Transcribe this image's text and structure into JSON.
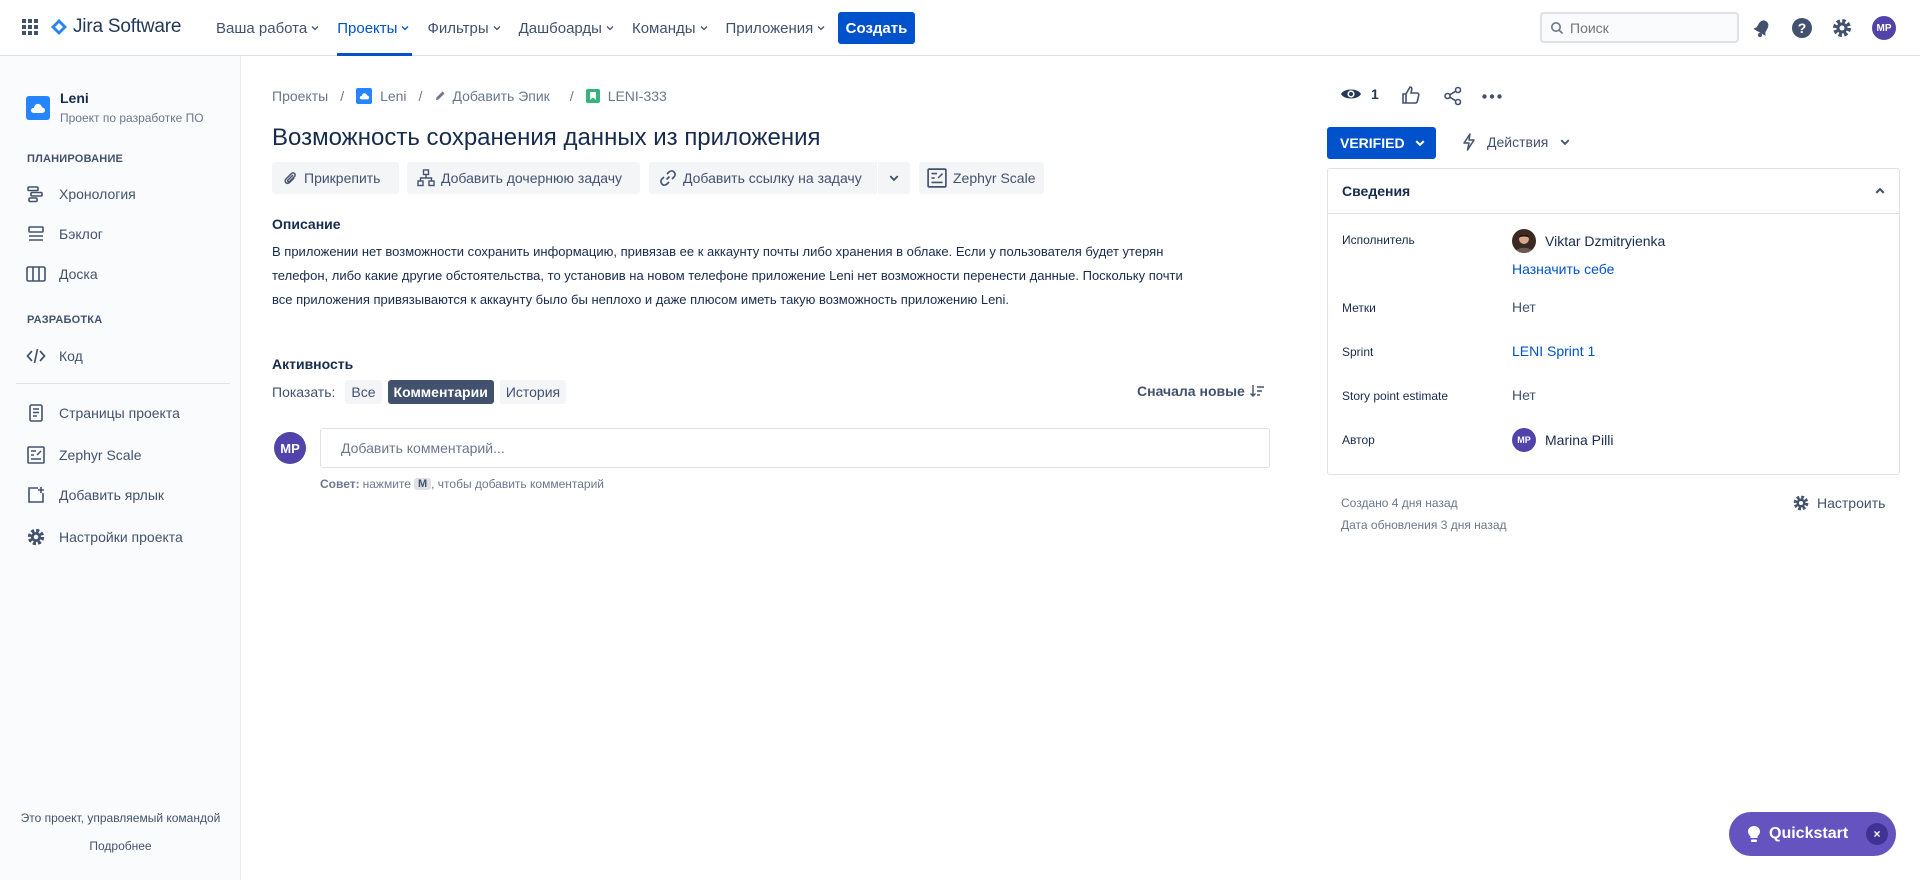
{
  "app": {
    "logo_text": "Jira Software",
    "brand_color": "#0052cc"
  },
  "nav": {
    "items": [
      {
        "label": "Ваша работа"
      },
      {
        "label": "Проекты"
      },
      {
        "label": "Фильтры"
      },
      {
        "label": "Дашбоарды"
      },
      {
        "label": "Команды"
      },
      {
        "label": "Приложения"
      }
    ],
    "active": "Проекты",
    "create_label": "Создать",
    "search_placeholder": "Поиск",
    "user_initials": "MP"
  },
  "sidebar": {
    "project_name": "Leni",
    "project_desc": "Проект по разработке ПО",
    "section_planning": "ПЛАНИРОВАНИЕ",
    "section_dev": "РАЗРАБОТКА",
    "items": {
      "timeline": "Хронология",
      "backlog": "Бэклог",
      "board": "Доска",
      "code": "Код",
      "pages": "Страницы проекта",
      "zephyr": "Zephyr Scale",
      "shortcut": "Добавить ярлык",
      "settings": "Настройки проекта"
    },
    "footer_text": "Это проект, управляемый командой",
    "footer_link": "Подробнее"
  },
  "issue": {
    "breadcrumb": {
      "projects": "Проекты",
      "project": "Leni",
      "epic": "Добавить Эпик",
      "key": "LENI-333"
    },
    "title": "Возможность сохранения данных из приложения",
    "toolbar": {
      "attach": "Прикрепить",
      "child": "Добавить дочернюю задачу",
      "link": "Добавить ссылку на задачу",
      "zephyr": "Zephyr Scale"
    },
    "description_label": "Описание",
    "description_lines": [
      "В приложении нет возможности сохранить информацию, привязав ее к аккаунту почты либо хранения в облаке. Если у пользователя будет утерян",
      "телефон, либо какие другие обстоятельства, то установив на новом телефоне приложение Leni нет возможности перенести данные. Поскольку почти",
      "все приложения привязываются к аккаунту было бы неплохо и даже плюсом иметь такую возможность приложению Leni."
    ],
    "activity": {
      "label": "Активность",
      "show_label": "Показать:",
      "filters": [
        "Все",
        "Комментарии",
        "История"
      ],
      "selected": "Комментарии",
      "sort_label": "Сначала новые",
      "comment_placeholder": "Добавить комментарий...",
      "tip_bold": "Совет:",
      "tip_pre": "нажмите",
      "tip_key": "M",
      "tip_post": ", чтобы добавить комментарий",
      "user_initials": "MP"
    }
  },
  "right": {
    "watch_count": "1",
    "status": "VERIFIED",
    "status_color": "#0052cc",
    "actions_label": "Действия",
    "details_title": "Сведения",
    "fields": {
      "assignee_label": "Исполнитель",
      "assignee_value": "Viktar Dzmitryienka",
      "assign_self": "Назначить себе",
      "labels_label": "Метки",
      "labels_value": "Нет",
      "sprint_label": "Sprint",
      "sprint_value": "LENI Sprint 1",
      "spe_label": "Story point estimate",
      "spe_value": "Нет",
      "reporter_label": "Автор",
      "reporter_value": "Marina Pilli",
      "reporter_initials": "MP"
    },
    "created": "Создано 4 дня назад",
    "updated": "Дата обновления 3 дня назад",
    "configure": "Настроить"
  },
  "quickstart": {
    "label": "Quickstart",
    "close": "×"
  }
}
